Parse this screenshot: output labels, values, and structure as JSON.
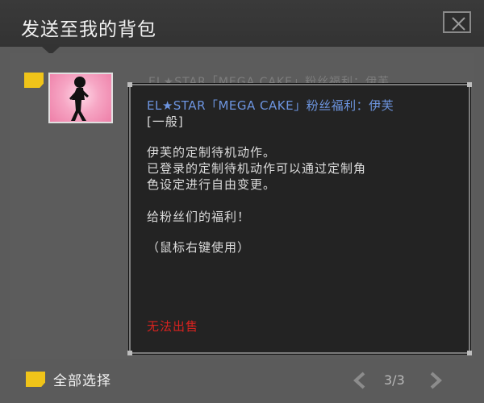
{
  "dialog": {
    "title": "发送至我的背包"
  },
  "item": {
    "name_preview": "EL★STAR「MEGA CAKE」粉丝福利：伊芙",
    "thumbnail": "dancer-silhouette-thumbnail"
  },
  "tooltip": {
    "name": "EL★STAR「MEGA CAKE」粉丝福利：伊芙",
    "grade": "[一般]",
    "desc_line1": "伊芙的定制待机动作。",
    "desc_line2": "已登录的定制待机动作可以通过定制角",
    "desc_line3": "色设定进行自由变更。",
    "desc_line4": "给粉丝们的福利！",
    "usage": "（鼠标右键使用）",
    "warning": "无法出售",
    "colors": {
      "name": "#6d95e0",
      "warning": "#d8231f"
    }
  },
  "footer": {
    "select_all_label": "全部选择",
    "page_indicator": "3/3"
  },
  "icons": {
    "close": "close-icon",
    "checkbox": "checkbox-icon",
    "prev": "chevron-left-icon",
    "next": "chevron-right-icon"
  },
  "colors": {
    "accent_yellow": "#f0c419",
    "window_bg": "#5b5b5b",
    "titlebar_bg": "#333333"
  }
}
